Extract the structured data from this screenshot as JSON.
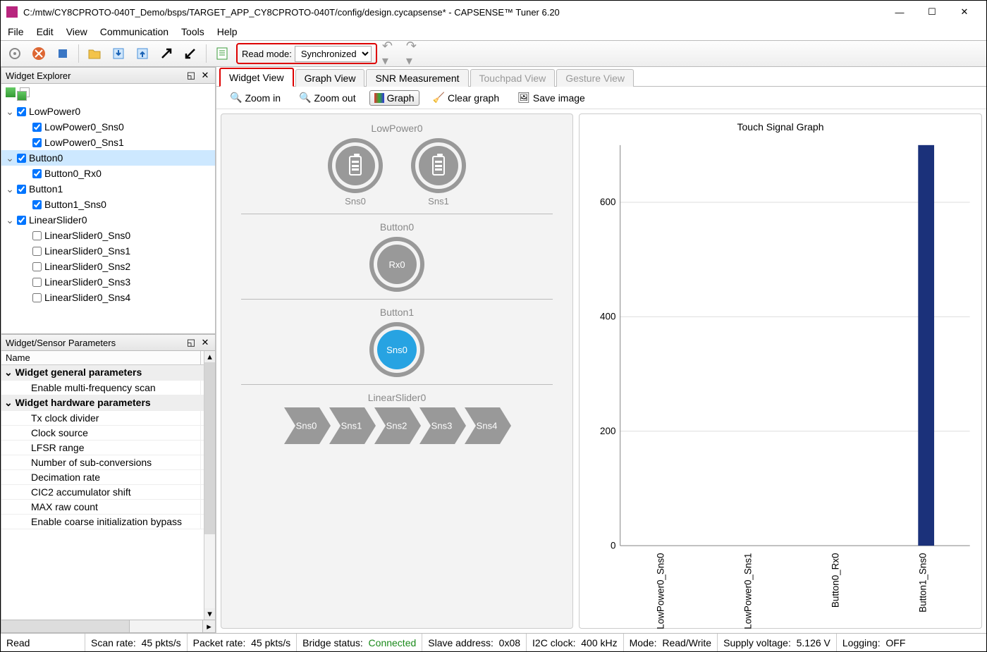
{
  "window": {
    "title": "C:/mtw/CY8CPROTO-040T_Demo/bsps/TARGET_APP_CY8CPROTO-040T/config/design.cycapsense* - CAPSENSE™ Tuner 6.20"
  },
  "menus": [
    "File",
    "Edit",
    "View",
    "Communication",
    "Tools",
    "Help"
  ],
  "toolbar": {
    "read_mode_label": "Read mode:",
    "read_mode_value": "Synchronized"
  },
  "panels": {
    "explorer_title": "Widget Explorer",
    "params_title": "Widget/Sensor Parameters",
    "params_name_col": "Name"
  },
  "tree": [
    {
      "level": 0,
      "exp": true,
      "chk": true,
      "label": "LowPower0"
    },
    {
      "level": 1,
      "exp": null,
      "chk": true,
      "label": "LowPower0_Sns0"
    },
    {
      "level": 1,
      "exp": null,
      "chk": true,
      "label": "LowPower0_Sns1"
    },
    {
      "level": 0,
      "exp": true,
      "chk": true,
      "label": "Button0",
      "selected": true
    },
    {
      "level": 1,
      "exp": null,
      "chk": true,
      "label": "Button0_Rx0"
    },
    {
      "level": 0,
      "exp": true,
      "chk": true,
      "label": "Button1"
    },
    {
      "level": 1,
      "exp": null,
      "chk": true,
      "label": "Button1_Sns0"
    },
    {
      "level": 0,
      "exp": true,
      "chk": true,
      "label": "LinearSlider0"
    },
    {
      "level": 1,
      "exp": null,
      "chk": false,
      "label": "LinearSlider0_Sns0"
    },
    {
      "level": 1,
      "exp": null,
      "chk": false,
      "label": "LinearSlider0_Sns1"
    },
    {
      "level": 1,
      "exp": null,
      "chk": false,
      "label": "LinearSlider0_Sns2"
    },
    {
      "level": 1,
      "exp": null,
      "chk": false,
      "label": "LinearSlider0_Sns3"
    },
    {
      "level": 1,
      "exp": null,
      "chk": false,
      "label": "LinearSlider0_Sns4"
    }
  ],
  "param_groups": [
    {
      "title": "Widget general parameters",
      "rows": [
        "Enable multi-frequency scan"
      ]
    },
    {
      "title": "Widget hardware parameters",
      "rows": [
        "Tx clock divider",
        "Clock source",
        "LFSR range",
        "Number of sub-conversions",
        "Decimation rate",
        "CIC2 accumulator shift",
        "MAX raw count",
        "Enable coarse initialization bypass"
      ]
    }
  ],
  "tabs": [
    {
      "label": "Widget View",
      "state": "active"
    },
    {
      "label": "Graph View",
      "state": "normal"
    },
    {
      "label": "SNR Measurement",
      "state": "normal"
    },
    {
      "label": "Touchpad View",
      "state": "disabled"
    },
    {
      "label": "Gesture View",
      "state": "disabled"
    }
  ],
  "subtoolbar": {
    "zoom_in": "Zoom in",
    "zoom_out": "Zoom out",
    "graph": "Graph",
    "clear": "Clear graph",
    "save": "Save image"
  },
  "widget_view": {
    "groups": [
      {
        "title": "LowPower0",
        "type": "battery",
        "sensors": [
          {
            "label": "Sns0"
          },
          {
            "label": "Sns1"
          }
        ]
      },
      {
        "title": "Button0",
        "type": "button",
        "sensors": [
          {
            "label": "Rx0"
          }
        ]
      },
      {
        "title": "Button1",
        "type": "button",
        "sensors": [
          {
            "label": "Sns0",
            "active": true
          }
        ]
      },
      {
        "title": "LinearSlider0",
        "type": "slider",
        "sensors": [
          {
            "label": "Sns0"
          },
          {
            "label": "Sns1"
          },
          {
            "label": "Sns2"
          },
          {
            "label": "Sns3"
          },
          {
            "label": "Sns4"
          }
        ]
      }
    ]
  },
  "chart_data": {
    "type": "bar",
    "title": "Touch Signal Graph",
    "categories": [
      "LowPower0_Sns0",
      "LowPower0_Sns1",
      "Button0_Rx0",
      "Button1_Sns0"
    ],
    "values": [
      0,
      0,
      0,
      700
    ],
    "ylim": [
      0,
      700
    ],
    "yticks": [
      0,
      200,
      400,
      600
    ],
    "bar_color": "#1b317a"
  },
  "status": {
    "mode": "Read",
    "scan_rate_label": "Scan rate:",
    "scan_rate_value": "45 pkts/s",
    "packet_rate_label": "Packet rate:",
    "packet_rate_value": "45 pkts/s",
    "bridge_label": "Bridge status:",
    "bridge_value": "Connected",
    "slave_label": "Slave address:",
    "slave_value": "0x08",
    "i2c_label": "I2C clock:",
    "i2c_value": "400 kHz",
    "rw_label": "Mode:",
    "rw_value": "Read/Write",
    "supply_label": "Supply voltage:",
    "supply_value": "5.126 V",
    "log_label": "Logging:",
    "log_value": "OFF"
  }
}
